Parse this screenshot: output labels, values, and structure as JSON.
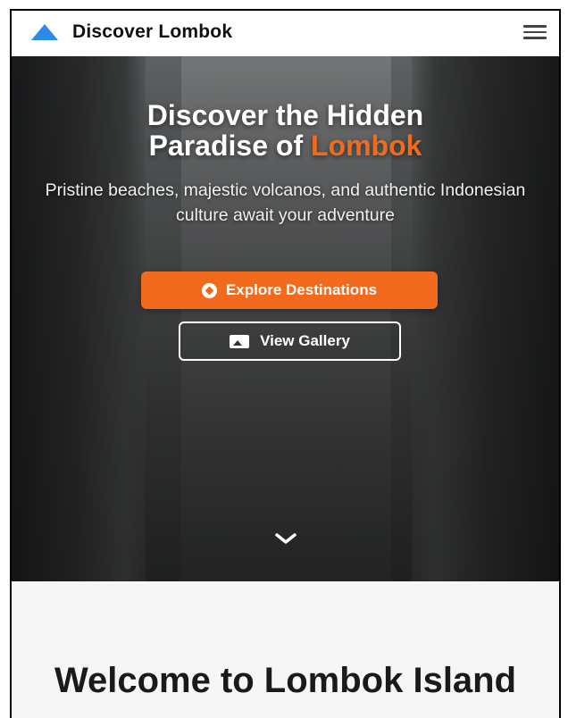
{
  "navbar": {
    "brand": "Discover Lombok",
    "logo_icon": "mountain-icon",
    "menu_icon": "hamburger-menu-icon"
  },
  "hero": {
    "title_line1": "Discover the Hidden",
    "title_line2_prefix": "Paradise of ",
    "title_line2_accent": "Lombok",
    "subtitle": "Pristine beaches, majestic volcanos, and authentic Indonesian culture await your adventure",
    "primary_button": {
      "label": "Explore Destinations",
      "icon": "compass-icon"
    },
    "secondary_button": {
      "label": "View Gallery",
      "icon": "image-icon"
    },
    "scroll_icon": "chevron-down-icon"
  },
  "welcome": {
    "title": "Welcome to Lombok Island"
  },
  "colors": {
    "accent": "#f26a1b",
    "logo": "#2a8be8",
    "text_dark": "#111111",
    "section_bg": "#f6f6f6"
  }
}
